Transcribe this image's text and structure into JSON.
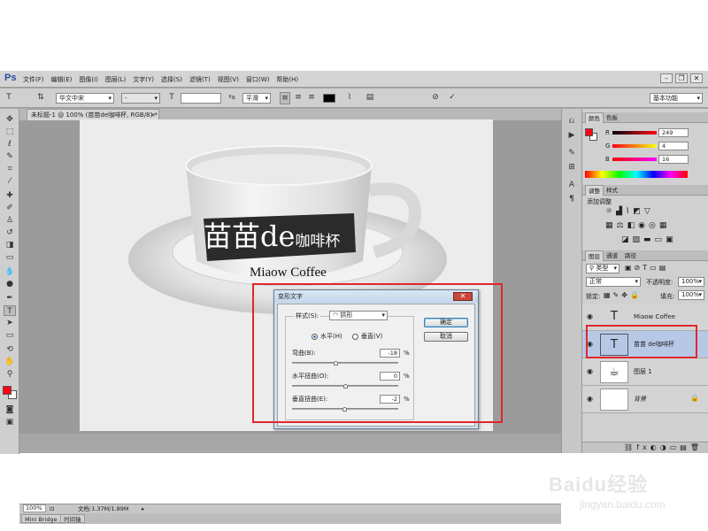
{
  "app": {
    "logo": "Ps"
  },
  "menu": [
    "文件(F)",
    "编辑(E)",
    "图像(I)",
    "图层(L)",
    "文字(Y)",
    "选择(S)",
    "滤镜(T)",
    "视图(V)",
    "窗口(W)",
    "帮助(H)"
  ],
  "options": {
    "font_family": "华文中宋",
    "font_size_sel": "-",
    "antialias": "平滑",
    "workspace": "基本功能"
  },
  "document": {
    "tab_title": "未标题-1 @ 100% (苗苗de咖啡杯, RGB/8) *",
    "zoom": "100%",
    "doc_info": "文档:1.37M/1.89M"
  },
  "artwork": {
    "cup_text_big": "苗苗de",
    "cup_text_small": "咖啡杯",
    "sub_text": "Miaow Coffee"
  },
  "bottom_tabs": [
    "Mini Bridge",
    "时间轴"
  ],
  "color_panel": {
    "tabs": [
      "颜色",
      "色板"
    ],
    "r_label": "R",
    "g_label": "G",
    "b_label": "B",
    "r": "249",
    "g": "4",
    "b": "16",
    "fg_color": "#f90410"
  },
  "adjust_panel": {
    "tabs": [
      "调整",
      "样式"
    ],
    "add_label": "添加调整"
  },
  "layers_panel": {
    "tabs": [
      "图层",
      "通道",
      "路径"
    ],
    "kind_label": "类型",
    "blend_mode": "正常",
    "opacity_label": "不透明度:",
    "opacity": "100%",
    "lock_label": "锁定:",
    "fill_label": "填充:",
    "fill": "100%",
    "layers": [
      {
        "name": "Miaow Coffee",
        "type": "text"
      },
      {
        "name": "苗苗 de咖啡杯",
        "type": "text"
      },
      {
        "name": "图层 1",
        "type": "image"
      },
      {
        "name": "背景",
        "type": "background"
      }
    ]
  },
  "dialog": {
    "title": "变形文字",
    "style_label": "样式(S):",
    "style_value": "拱形",
    "ok": "确定",
    "cancel": "取消",
    "horizontal": "水平(H)",
    "vertical": "垂直(V)",
    "orientation_selected": "horizontal",
    "bend_label": "弯曲(B):",
    "bend": "-18",
    "h_distort_label": "水平扭曲(O):",
    "h_distort": "0",
    "v_distort_label": "垂直扭曲(E):",
    "v_distort": "-2",
    "pct": "%"
  },
  "watermark": {
    "brand": "Baidu经验",
    "url": "jingyan.baidu.com"
  }
}
